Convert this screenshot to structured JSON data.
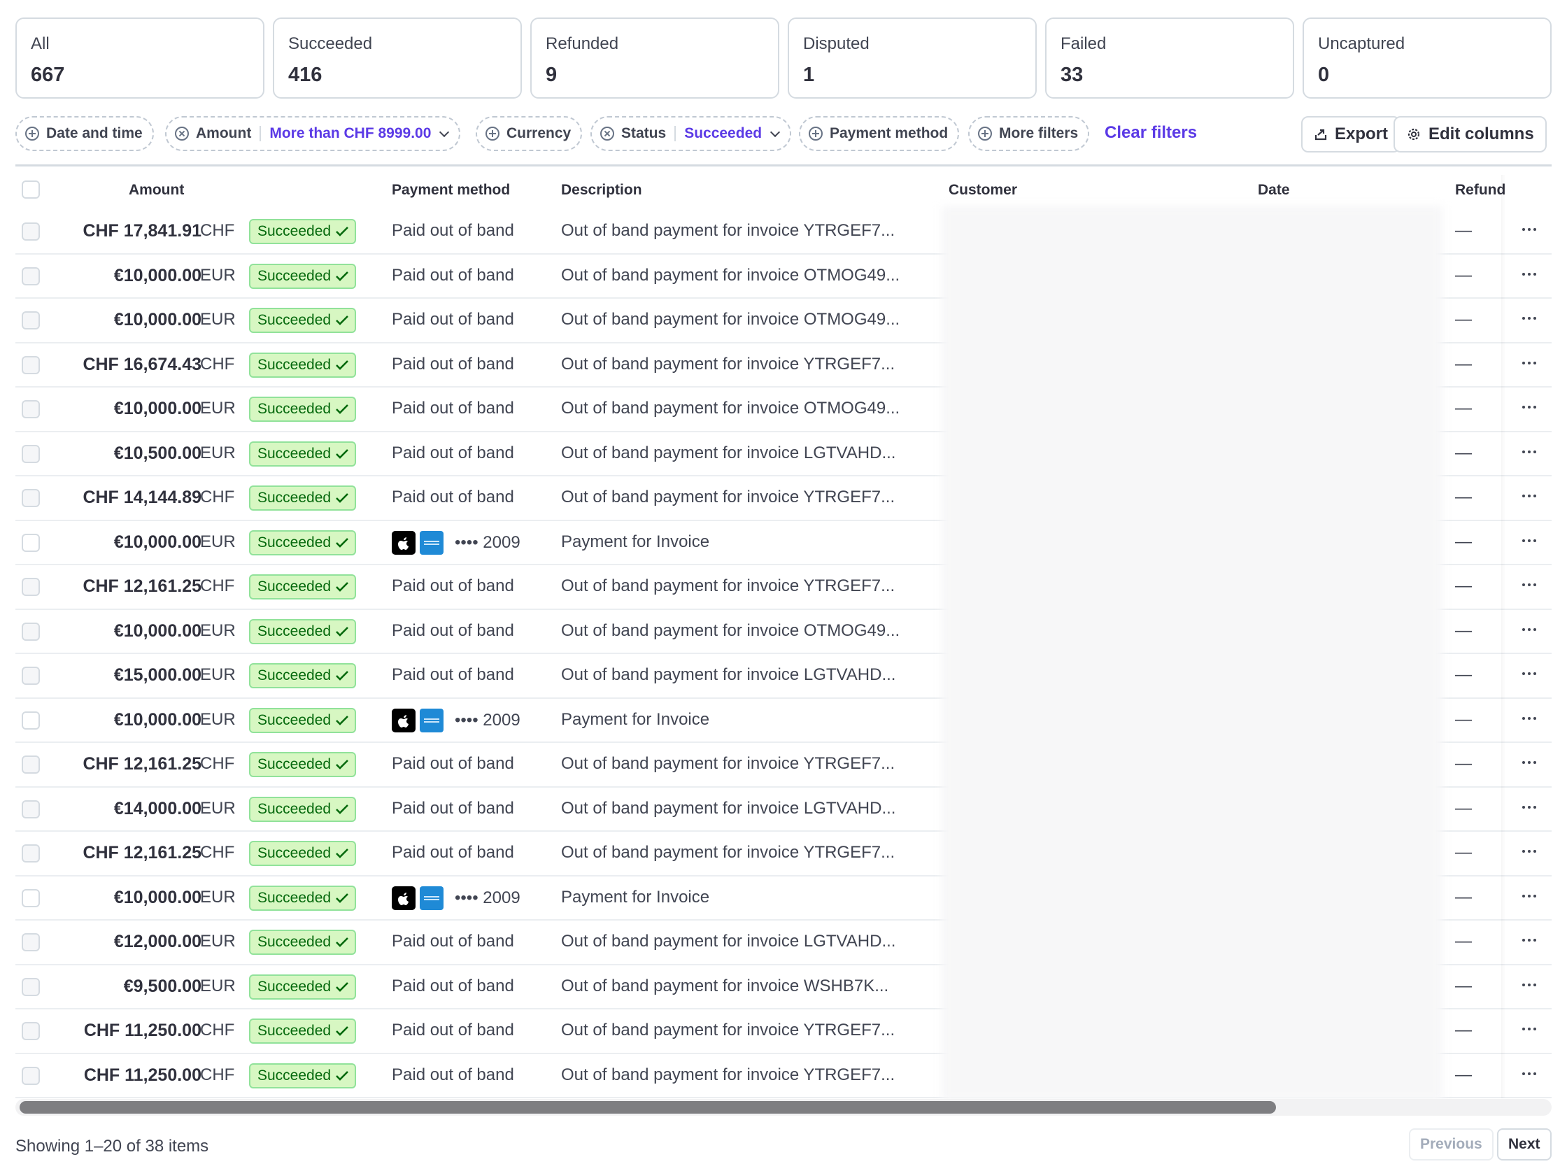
{
  "tabs": [
    {
      "label": "All",
      "count": "667"
    },
    {
      "label": "Succeeded",
      "count": "416"
    },
    {
      "label": "Refunded",
      "count": "9"
    },
    {
      "label": "Disputed",
      "count": "1"
    },
    {
      "label": "Failed",
      "count": "33"
    },
    {
      "label": "Uncaptured",
      "count": "0"
    }
  ],
  "filters": {
    "date": "Date and time",
    "amount_label": "Amount",
    "amount_value": "More than CHF 8999.00",
    "currency": "Currency",
    "status_label": "Status",
    "status_value": "Succeeded",
    "payment_method": "Payment method",
    "more_filters": "More filters",
    "clear": "Clear filters"
  },
  "toolbar": {
    "export": "Export",
    "edit_columns": "Edit columns"
  },
  "columns": {
    "amount": "Amount",
    "payment_method": "Payment method",
    "description": "Description",
    "customer": "Customer",
    "date": "Date",
    "refund": "Refund"
  },
  "rows": [
    {
      "amount": "CHF 17,841.91",
      "currency": "CHF",
      "status": "Succeeded",
      "method": "Paid out of band",
      "card": false,
      "description": "Out of band payment for invoice YTRGEF7...",
      "refund": "—"
    },
    {
      "amount": "€10,000.00",
      "currency": "EUR",
      "status": "Succeeded",
      "method": "Paid out of band",
      "card": false,
      "description": "Out of band payment for invoice OTMOG49...",
      "refund": "—"
    },
    {
      "amount": "€10,000.00",
      "currency": "EUR",
      "status": "Succeeded",
      "method": "Paid out of band",
      "card": false,
      "description": "Out of band payment for invoice OTMOG49...",
      "refund": "—"
    },
    {
      "amount": "CHF 16,674.43",
      "currency": "CHF",
      "status": "Succeeded",
      "method": "Paid out of band",
      "card": false,
      "description": "Out of band payment for invoice YTRGEF7...",
      "refund": "—"
    },
    {
      "amount": "€10,000.00",
      "currency": "EUR",
      "status": "Succeeded",
      "method": "Paid out of band",
      "card": false,
      "description": "Out of band payment for invoice OTMOG49...",
      "refund": "—"
    },
    {
      "amount": "€10,500.00",
      "currency": "EUR",
      "status": "Succeeded",
      "method": "Paid out of band",
      "card": false,
      "description": "Out of band payment for invoice LGTVAHD...",
      "refund": "—"
    },
    {
      "amount": "CHF 14,144.89",
      "currency": "CHF",
      "status": "Succeeded",
      "method": "Paid out of band",
      "card": false,
      "description": "Out of band payment for invoice YTRGEF7...",
      "refund": "—"
    },
    {
      "amount": "€10,000.00",
      "currency": "EUR",
      "status": "Succeeded",
      "method": "•••• 2009",
      "card": true,
      "description": "Payment for Invoice",
      "refund": "—"
    },
    {
      "amount": "CHF 12,161.25",
      "currency": "CHF",
      "status": "Succeeded",
      "method": "Paid out of band",
      "card": false,
      "description": "Out of band payment for invoice YTRGEF7...",
      "refund": "—"
    },
    {
      "amount": "€10,000.00",
      "currency": "EUR",
      "status": "Succeeded",
      "method": "Paid out of band",
      "card": false,
      "description": "Out of band payment for invoice OTMOG49...",
      "refund": "—"
    },
    {
      "amount": "€15,000.00",
      "currency": "EUR",
      "status": "Succeeded",
      "method": "Paid out of band",
      "card": false,
      "description": "Out of band payment for invoice LGTVAHD...",
      "refund": "—"
    },
    {
      "amount": "€10,000.00",
      "currency": "EUR",
      "status": "Succeeded",
      "method": "•••• 2009",
      "card": true,
      "description": "Payment for Invoice",
      "refund": "—"
    },
    {
      "amount": "CHF 12,161.25",
      "currency": "CHF",
      "status": "Succeeded",
      "method": "Paid out of band",
      "card": false,
      "description": "Out of band payment for invoice YTRGEF7...",
      "refund": "—"
    },
    {
      "amount": "€14,000.00",
      "currency": "EUR",
      "status": "Succeeded",
      "method": "Paid out of band",
      "card": false,
      "description": "Out of band payment for invoice LGTVAHD...",
      "refund": "—"
    },
    {
      "amount": "CHF 12,161.25",
      "currency": "CHF",
      "status": "Succeeded",
      "method": "Paid out of band",
      "card": false,
      "description": "Out of band payment for invoice YTRGEF7...",
      "refund": "—"
    },
    {
      "amount": "€10,000.00",
      "currency": "EUR",
      "status": "Succeeded",
      "method": "•••• 2009",
      "card": true,
      "description": "Payment for Invoice",
      "refund": "—"
    },
    {
      "amount": "€12,000.00",
      "currency": "EUR",
      "status": "Succeeded",
      "method": "Paid out of band",
      "card": false,
      "description": "Out of band payment for invoice LGTVAHD...",
      "refund": "—"
    },
    {
      "amount": "€9,500.00",
      "currency": "EUR",
      "status": "Succeeded",
      "method": "Paid out of band",
      "card": false,
      "description": "Out of band payment for invoice WSHB7K...",
      "refund": "—"
    },
    {
      "amount": "CHF 11,250.00",
      "currency": "CHF",
      "status": "Succeeded",
      "method": "Paid out of band",
      "card": false,
      "description": "Out of band payment for invoice YTRGEF7...",
      "refund": "—"
    },
    {
      "amount": "CHF 11,250.00",
      "currency": "CHF",
      "status": "Succeeded",
      "method": "Paid out of band",
      "card": false,
      "description": "Out of band payment for invoice YTRGEF7...",
      "refund": "—"
    }
  ],
  "footer": {
    "showing": "Showing 1–20 of 38 items",
    "previous": "Previous",
    "next": "Next"
  },
  "colors": {
    "accent": "#5b3ae6",
    "success_bg": "#d7f7c2",
    "success_text": "#05690d",
    "border": "#d5dbe1"
  },
  "icons": [
    "plus-circle-icon",
    "x-circle-icon",
    "chevron-down-icon",
    "export-icon",
    "gear-icon",
    "check-icon",
    "apple-pay-icon",
    "amex-card-icon",
    "more-horizontal-icon"
  ]
}
